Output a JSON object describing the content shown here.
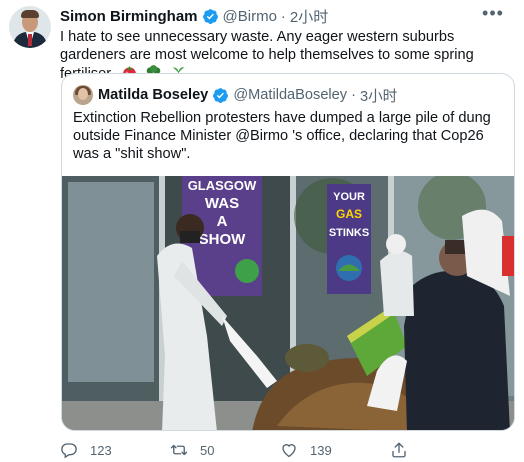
{
  "author": {
    "name": "Simon Birmingham",
    "handle": "@Birmo",
    "separator": "·",
    "time": "2小时"
  },
  "tweet": {
    "text": "I hate to see unnecessary waste. Any eager western suburbs gardeners are most welcome to help themselves to some spring fertiliser.",
    "emojis": [
      "tomato-icon",
      "broccoli-icon",
      "potted-plant-icon"
    ]
  },
  "quoted": {
    "name": "Matilda Boseley",
    "handle": "@MatildaBoseley",
    "separator": "·",
    "time": "3小时",
    "text": "Extinction Rebellion protesters have dumped a large pile of dung outside Finance Minister @Birmo 's office, declaring that Cop26 was a \"shit show\".",
    "photo_signs": {
      "left": [
        "GLASGOW",
        "WAS",
        "A",
        "SHOW"
      ],
      "right": [
        "YOUR",
        "GAS",
        "STINKS"
      ]
    }
  },
  "actions": {
    "reply_count": "123",
    "retweet_count": "50",
    "like_count": "139"
  },
  "colors": {
    "text": "#0f1419",
    "secondary": "#536471",
    "verified": "#1d9bf0",
    "border": "#cfd9de"
  }
}
